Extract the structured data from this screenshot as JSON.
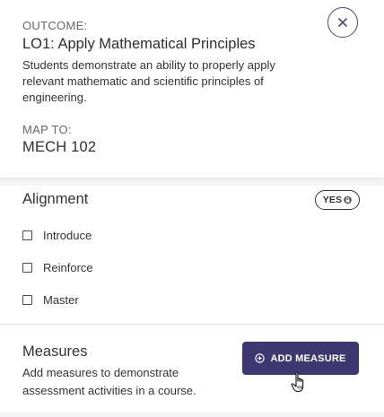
{
  "outcome": {
    "label": "OUTCOME:",
    "title": "LO1: Apply Mathematical Principles",
    "description": "Students demonstrate an ability to properly apply relevant mathematic and scientific principles of engineering."
  },
  "map": {
    "label": "MAP TO:",
    "value": "MECH 102"
  },
  "alignment": {
    "title": "Alignment",
    "badge_label": "YES",
    "options": [
      {
        "label": "Introduce",
        "checked": false
      },
      {
        "label": "Reinforce",
        "checked": false
      },
      {
        "label": "Master",
        "checked": false
      }
    ]
  },
  "measures": {
    "title": "Measures",
    "description": "Add measures to demonstrate assessment activities in a course.",
    "add_button_label": "ADD MEASURE"
  },
  "colors": {
    "accent": "#3d3870",
    "background": "#f4f4f6"
  },
  "icons": {
    "close": "close-icon",
    "lock": "lock-icon",
    "add": "plus-circle-icon",
    "cursor": "hand-pointer-icon"
  }
}
